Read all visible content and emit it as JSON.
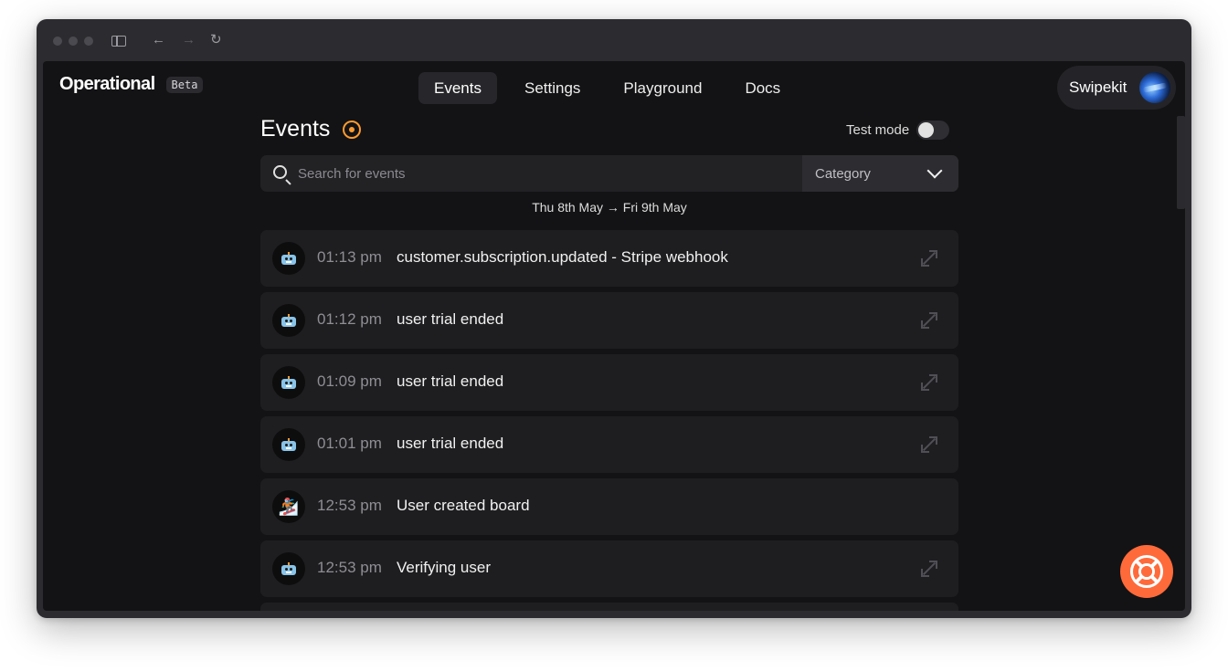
{
  "browser": {
    "back_icon": "arrow-left-icon",
    "forward_icon": "arrow-right-icon",
    "reload_icon": "reload-icon",
    "sidebar_icon": "sidebar-toggle-icon"
  },
  "app": {
    "brand": "Operational",
    "badge": "Beta"
  },
  "nav": {
    "items": [
      {
        "label": "Events",
        "active": true
      },
      {
        "label": "Settings",
        "active": false
      },
      {
        "label": "Playground",
        "active": false
      },
      {
        "label": "Docs",
        "active": false
      }
    ]
  },
  "account": {
    "name": "Swipekit"
  },
  "page": {
    "title": "Events",
    "test_mode_label": "Test mode",
    "test_mode_on": false
  },
  "search": {
    "placeholder": "Search for events",
    "value": "",
    "category_label": "Category"
  },
  "date_range": "Thu 8th May → Fri 9th May",
  "events": [
    {
      "icon": "robot-icon",
      "time": "01:13 pm",
      "name": "customer.subscription.updated - Stripe webhook",
      "expandable": true
    },
    {
      "icon": "robot-icon",
      "time": "01:12 pm",
      "name": "user trial ended",
      "expandable": true
    },
    {
      "icon": "robot-icon",
      "time": "01:09 pm",
      "name": "user trial ended",
      "expandable": true
    },
    {
      "icon": "robot-icon",
      "time": "01:01 pm",
      "name": "user trial ended",
      "expandable": true
    },
    {
      "icon": "snowboarder-icon",
      "time": "12:53 pm",
      "name": "User created board",
      "expandable": false
    },
    {
      "icon": "robot-icon",
      "time": "12:53 pm",
      "name": "Verifying user",
      "expandable": true
    }
  ],
  "colors": {
    "accent_orange": "#ff9b2f",
    "help_button": "#ff6a3a",
    "background": "#131315",
    "row": "#1e1e21"
  },
  "help": {
    "icon": "lifebuoy-icon"
  }
}
